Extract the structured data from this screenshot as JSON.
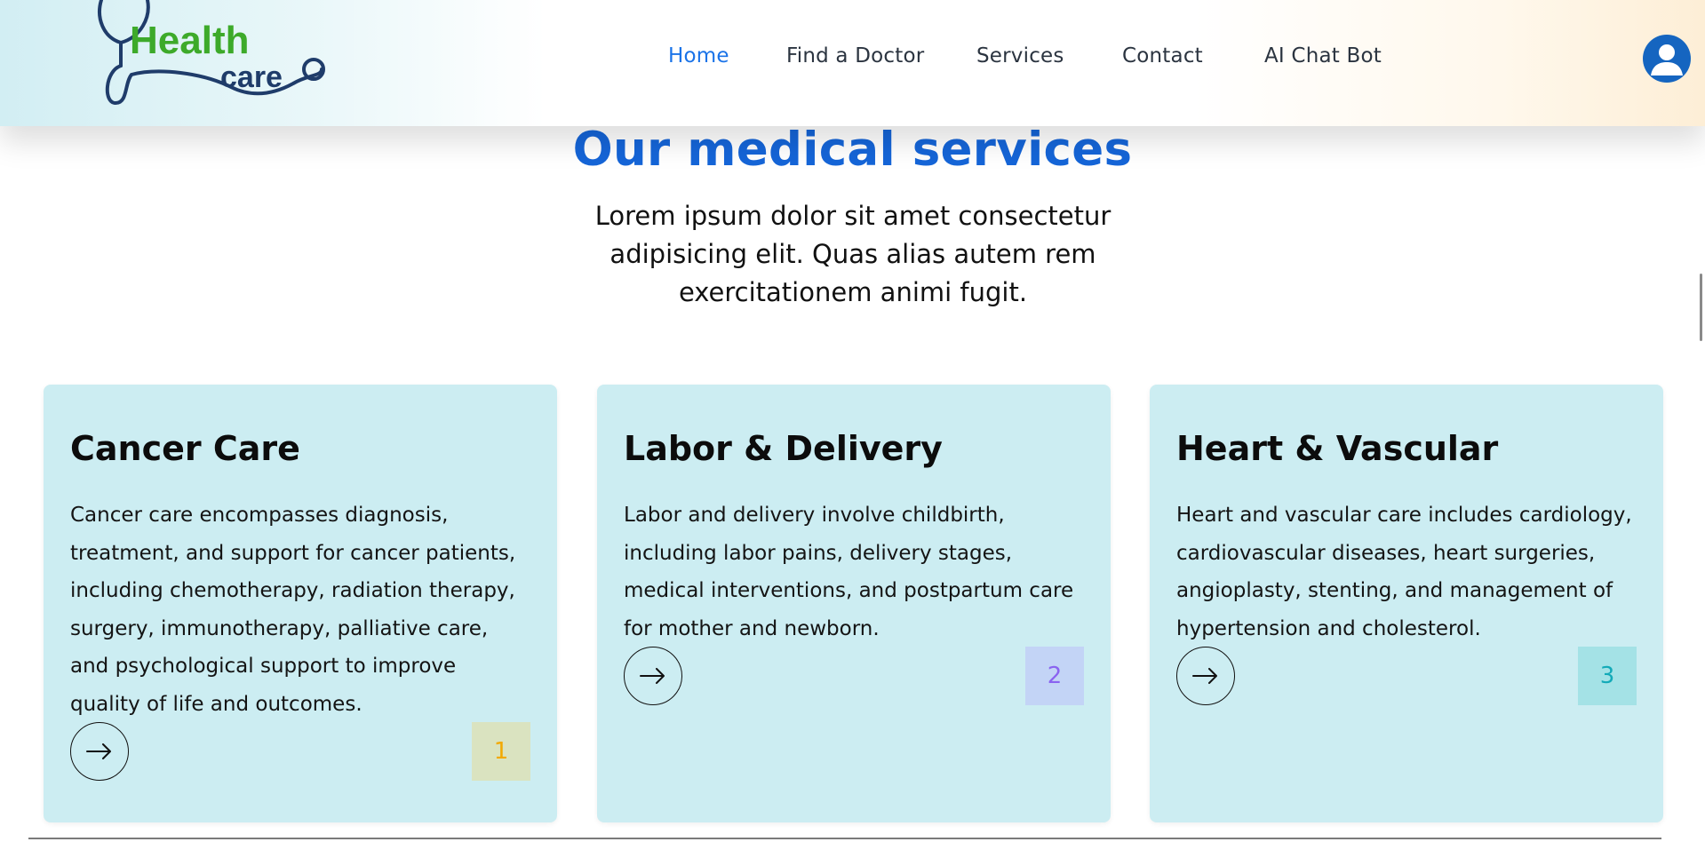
{
  "logo": {
    "line1": "Health",
    "line2": "care"
  },
  "nav": {
    "items": [
      {
        "label": "Home",
        "active": true
      },
      {
        "label": "Find a Doctor",
        "active": false
      },
      {
        "label": "Services",
        "active": false
      },
      {
        "label": "Contact",
        "active": false
      },
      {
        "label": "AI Chat Bot",
        "active": false
      }
    ],
    "avatar_icon": "user-avatar-icon"
  },
  "section": {
    "title": "Our medical services",
    "subtitle": "Lorem ipsum dolor sit amet consectetur adipisicing elit. Quas alias autem rem exercitationem animi fugit."
  },
  "cards": [
    {
      "title": "Cancer Care",
      "description": "Cancer care encompasses diagnosis, treatment, and support for cancer patients, including chemotherapy, radiation therapy, surgery, immunotherapy, palliative care, and psychological support to improve quality of life and outcomes.",
      "number": "1",
      "badge_bg": "#dae3c0",
      "badge_color": "#f2a900",
      "icon": "arrow-right-icon"
    },
    {
      "title": "Labor & Delivery",
      "description": "Labor and delivery involve childbirth, including labor pains, delivery stages, medical interventions, and postpartum care for mother and newborn.",
      "number": "2",
      "badge_bg": "#c3d4f6",
      "badge_color": "#8a63f0",
      "icon": "arrow-right-icon"
    },
    {
      "title": "Heart & Vascular",
      "description": "Heart and vascular care includes cardiology, cardiovascular diseases, heart surgeries, angioplasty, stenting, and management of hypertension and cholesterol.",
      "number": "3",
      "badge_bg": "#a4e2e6",
      "badge_color": "#13aab8",
      "icon": "arrow-right-icon"
    }
  ],
  "colors": {
    "accent": "#1565d8",
    "logo_green": "#3daa2a",
    "logo_navy": "#1f3c6a",
    "card_bg": "#ccedf2"
  }
}
